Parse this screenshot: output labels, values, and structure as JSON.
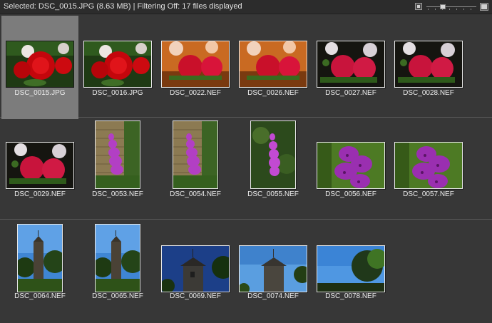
{
  "status": "Selected: DSC_0015.JPG (8.63 MB) | Filtering Off: 17 files displayed",
  "toolbar": {
    "small_view_icon": "small-thumbnails-icon",
    "large_view_icon": "large-thumbnails-icon",
    "zoom_level": 0.3
  },
  "files": [
    {
      "name": "DSC_0015.JPG",
      "subject": "red-roses",
      "selected": true
    },
    {
      "name": "DSC_0016.JPG",
      "subject": "red-roses"
    },
    {
      "name": "DSC_0022.NEF",
      "subject": "red-carnations-orange"
    },
    {
      "name": "DSC_0026.NEF",
      "subject": "red-carnations-orange"
    },
    {
      "name": "DSC_0027.NEF",
      "subject": "red-carnations-dark"
    },
    {
      "name": "DSC_0028.NEF",
      "subject": "red-carnations-dark"
    },
    {
      "name": "DSC_0029.NEF",
      "subject": "red-carnations-dark"
    },
    {
      "name": "DSC_0053.NEF",
      "subject": "foxglove-wall"
    },
    {
      "name": "DSC_0054.NEF",
      "subject": "foxglove-wall"
    },
    {
      "name": "DSC_0055.NEF",
      "subject": "foxglove-green"
    },
    {
      "name": "DSC_0056.NEF",
      "subject": "foxglove-closeup"
    },
    {
      "name": "DSC_0057.NEF",
      "subject": "foxglove-closeup"
    },
    {
      "name": "DSC_0064.NEF",
      "subject": "church-tower-portrait"
    },
    {
      "name": "DSC_0065.NEF",
      "subject": "church-tower-portrait"
    },
    {
      "name": "DSC_0069.NEF",
      "subject": "church-tower-dark"
    },
    {
      "name": "DSC_0074.NEF",
      "subject": "church-tower-blue"
    },
    {
      "name": "DSC_0078.NEF",
      "subject": "tree-sky"
    }
  ]
}
